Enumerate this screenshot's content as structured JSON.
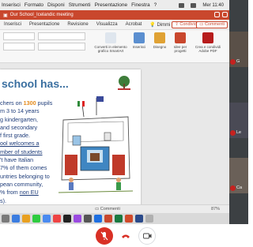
{
  "menubar": {
    "items": [
      "Inserisci",
      "Formato",
      "Disponi",
      "Strumenti",
      "Presentazione",
      "Finestra",
      "?"
    ],
    "clock": "Mer 11:40"
  },
  "titlebar": {
    "doc_title": "Our School_Icelandic meeting"
  },
  "ribbon_tabs": {
    "items": [
      "Inserisci",
      "Presentazione",
      "Revisione",
      "Visualizza",
      "Acrobat",
      "Dimmi"
    ],
    "active_index": 0,
    "share_label": "Condividi",
    "comments_label": "Commenti"
  },
  "ribbon": {
    "convert_label": "Converti in elemento grafico SmartArt",
    "insert_label": "Inserisci",
    "draw_label": "Disegno",
    "ideas_label": "Idee per progetti",
    "pdf_label": "Crea e condividi Adobe PDF"
  },
  "slide": {
    "title": "school has...",
    "lines": {
      "l1_pre": "chers on ",
      "l1_num": "1300",
      "l1_post": " pupils",
      "l2": "m 3 to 14 years",
      "l3": "g kindergarten,",
      "l4": "and secondary",
      "l5": "f first grade.",
      "l6": "ool welcomes a",
      "l7": "mber of students",
      "l8": "'t have Italian",
      "l9": "7% of them comes",
      "l10": "untries belonging to",
      "l11": "pean community,",
      "l12_pre": "% from ",
      "l12_link": "non EU",
      "l13": "s)."
    }
  },
  "status": {
    "comments": "Commenti",
    "zoom": "87%"
  },
  "participants": [
    {
      "initial": "G"
    },
    {
      "initial": "Le"
    },
    {
      "initial": "Ca"
    }
  ],
  "colors": {
    "ppt_red": "#c9472d",
    "slide_blue": "#1f3d7a",
    "highlight_orange": "#e48a1a",
    "meet_red": "#d93025"
  }
}
